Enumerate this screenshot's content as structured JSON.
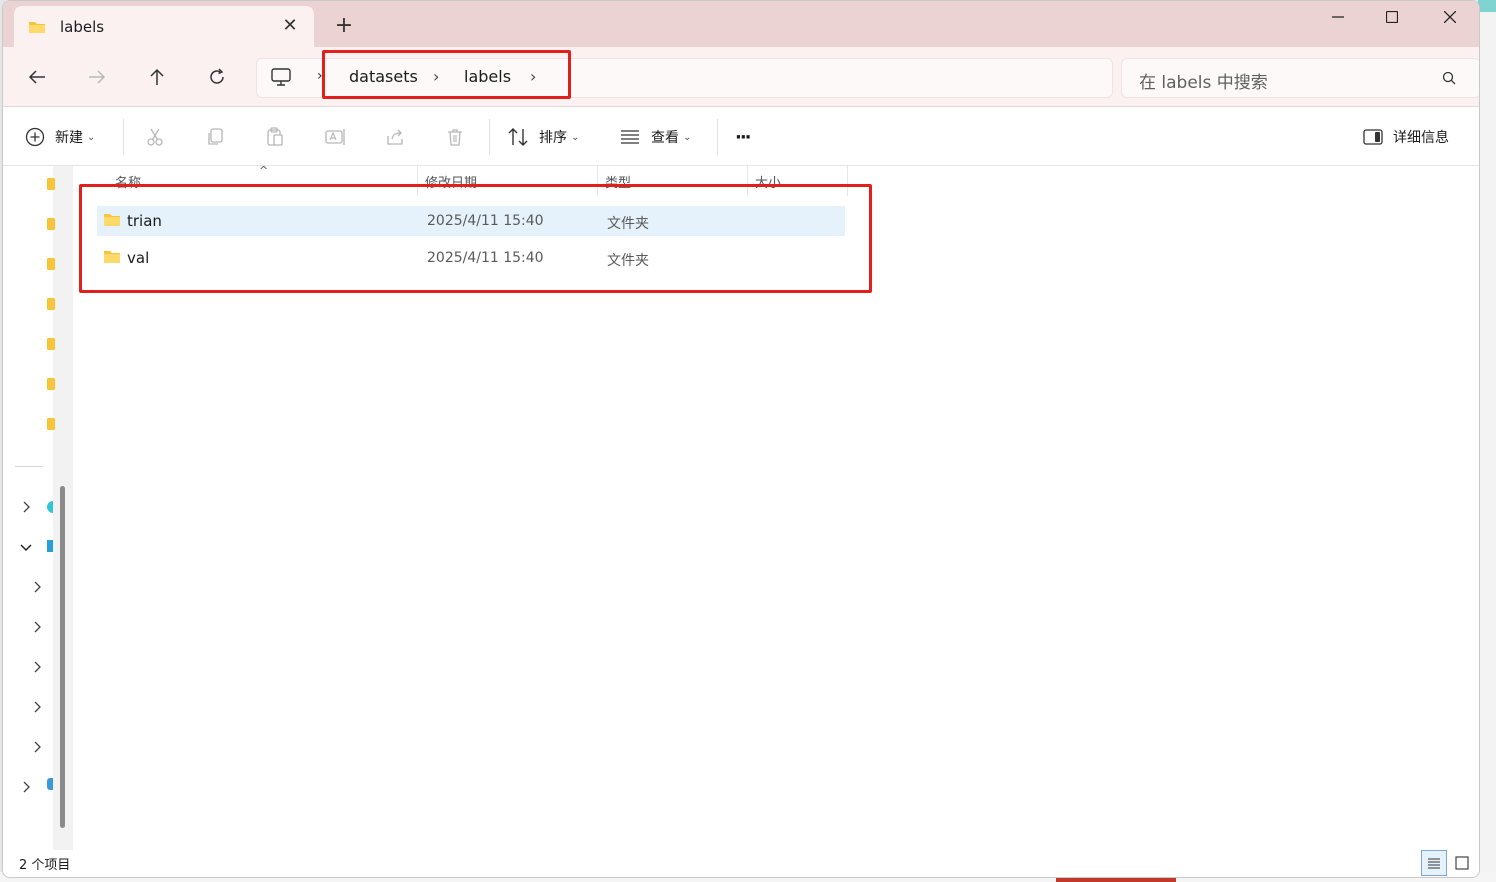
{
  "window": {
    "tab_title": "labels",
    "tab_close": "✕",
    "new_tab": "+"
  },
  "nav": {
    "breadcrumbs": [
      "datasets",
      "labels"
    ],
    "crumb_sep": "›",
    "search_placeholder": "在 labels 中搜索"
  },
  "commands": {
    "new_label": "新建",
    "sort_label": "排序",
    "view_label": "查看",
    "more_label": "···",
    "details_label": "详细信息"
  },
  "columns": [
    "名称",
    "修改日期",
    "类型",
    "大小"
  ],
  "files": [
    {
      "name": "trian",
      "modified": "2025/4/11 15:40",
      "type": "文件夹",
      "selected": true
    },
    {
      "name": "val",
      "modified": "2025/4/11 15:40",
      "type": "文件夹",
      "selected": false
    }
  ],
  "status": {
    "item_count": "2 个项目"
  },
  "colors": {
    "titlebar": "#ebd3d3",
    "navbar": "#fbf1f1",
    "annotation_red": "#e0201c",
    "selection": "#e5f1fb",
    "folder_yellow": "#f7c53a"
  },
  "icons": {
    "tab": "folder-icon",
    "back": "arrow-left-icon",
    "forward": "arrow-right-icon",
    "up": "arrow-up-icon",
    "refresh": "refresh-icon",
    "this_pc": "monitor-icon",
    "search": "search-icon"
  }
}
